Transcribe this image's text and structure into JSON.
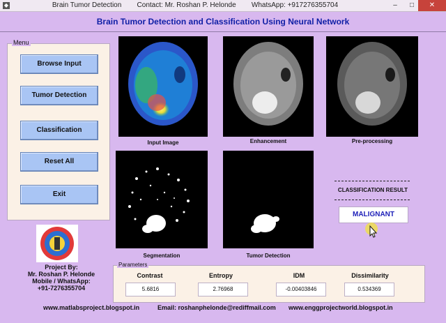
{
  "window": {
    "title_parts": [
      "Brain Tumor Detection",
      "Contact: Mr. Roshan P. Helonde",
      "WhatsApp: +917276355704"
    ],
    "app_icon": "matlab-figure-icon",
    "controls": {
      "minimize": "–",
      "maximize": "□",
      "close": "✕"
    }
  },
  "heading": "Brain Tumor Detection and Classification Using Neural Network",
  "menu": {
    "legend": "Menu",
    "buttons": [
      "Browse Input",
      "Tumor Detection",
      "Classification",
      "Reset All",
      "Exit"
    ]
  },
  "images": {
    "captions": [
      "Input Image",
      "Enhancement",
      "Pre-processing",
      "Segmentation",
      "Tumor Detection"
    ]
  },
  "result": {
    "label": "CLASSIFICATION RESULT",
    "value": "MALIGNANT"
  },
  "project": {
    "lines": [
      "Project By:",
      "Mr. Roshan P. Helonde",
      "Mobile / WhatsApp:",
      "+91-7276355704"
    ]
  },
  "parameters": {
    "legend": "Parameters",
    "labels": [
      "Contrast",
      "Entropy",
      "IDM",
      "Dissimilarity"
    ],
    "values": [
      "5.6816",
      "2.76968",
      "-0.00403846",
      "0.534369"
    ]
  },
  "footer": {
    "site1": "www.matlabsproject.blogspot.in",
    "email": "Email: roshanphelonde@rediffmail.com",
    "site2": "www.enggprojectworld.blogspot.in"
  },
  "colors": {
    "background": "#d8b8ef",
    "button": "#a9c5f4",
    "heading": "#0f1fa6",
    "result_text": "#1d1fb8",
    "close_button": "#c7433b"
  }
}
